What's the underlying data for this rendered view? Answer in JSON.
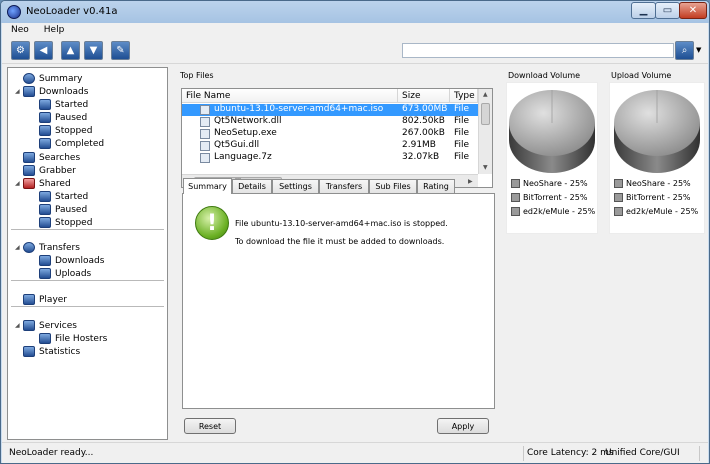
{
  "window": {
    "title": "NeoLoader v0.41a"
  },
  "menu": [
    "Neo",
    "Help"
  ],
  "toolbar": {
    "search_value": ""
  },
  "nav": {
    "items": [
      {
        "label": "Summary",
        "level": 0,
        "arrow": "",
        "icon": "summary-icon"
      },
      {
        "label": "Downloads",
        "level": 0,
        "arrow": "◢",
        "icon": "downloads-icon"
      },
      {
        "label": "Started",
        "level": 1,
        "arrow": "",
        "icon": "started-icon"
      },
      {
        "label": "Paused",
        "level": 1,
        "arrow": "",
        "icon": "paused-icon"
      },
      {
        "label": "Stopped",
        "level": 1,
        "arrow": "",
        "icon": "stopped-icon"
      },
      {
        "label": "Completed",
        "level": 1,
        "arrow": "",
        "icon": "completed-icon"
      },
      {
        "label": "Searches",
        "level": 0,
        "arrow": "",
        "icon": "searches-icon"
      },
      {
        "label": "Grabber",
        "level": 0,
        "arrow": "",
        "icon": "grabber-icon"
      },
      {
        "label": "Shared",
        "level": 0,
        "arrow": "◢",
        "icon": "shared-icon"
      },
      {
        "label": "Started",
        "level": 1,
        "arrow": "",
        "icon": "started-icon"
      },
      {
        "label": "Paused",
        "level": 1,
        "arrow": "",
        "icon": "paused-icon"
      },
      {
        "label": "Stopped",
        "level": 1,
        "arrow": "",
        "icon": "stopped-icon"
      },
      {
        "label": "Transfers",
        "level": 0,
        "arrow": "◢",
        "icon": "transfers-icon"
      },
      {
        "label": "Downloads",
        "level": 1,
        "arrow": "",
        "icon": "downloads-icon"
      },
      {
        "label": "Uploads",
        "level": 1,
        "arrow": "",
        "icon": "uploads-icon"
      },
      {
        "label": "Player",
        "level": 0,
        "arrow": "",
        "icon": "player-icon"
      },
      {
        "label": "Services",
        "level": 0,
        "arrow": "◢",
        "icon": "services-icon"
      },
      {
        "label": "File Hosters",
        "level": 1,
        "arrow": "",
        "icon": "file-hosters-icon"
      },
      {
        "label": "Statistics",
        "level": 0,
        "arrow": "",
        "icon": "statistics-icon"
      }
    ]
  },
  "top_files": {
    "title": "Top Files",
    "columns": [
      "File Name",
      "Size",
      "Type"
    ],
    "rows": [
      {
        "name": "ubuntu-13.10-server-amd64+mac.iso",
        "size": "673.00MB",
        "type": "File",
        "selected": true
      },
      {
        "name": "Qt5Network.dll",
        "size": "802.50kB",
        "type": "File",
        "selected": false
      },
      {
        "name": "NeoSetup.exe",
        "size": "267.00kB",
        "type": "File",
        "selected": false
      },
      {
        "name": "Qt5Gui.dll",
        "size": "2.91MB",
        "type": "File",
        "selected": false
      },
      {
        "name": "Language.7z",
        "size": "32.07kB",
        "type": "File",
        "selected": false
      }
    ]
  },
  "tabs": [
    "Summary",
    "Details",
    "Settings",
    "Transfers",
    "Sub Files",
    "Rating"
  ],
  "summary": {
    "line1": "File ubuntu-13.10-server-amd64+mac.iso is stopped.",
    "line2": "To download the file it must be added to downloads."
  },
  "buttons": {
    "reset": "Reset",
    "apply": "Apply"
  },
  "download_volume": {
    "title": "Download Volume",
    "legend": [
      "NeoShare - 25%",
      "BitTorrent - 25%",
      "ed2k/eMule - 25%"
    ]
  },
  "upload_volume": {
    "title": "Upload Volume",
    "legend": [
      "NeoShare - 25%",
      "BitTorrent - 25%",
      "ed2k/eMule - 25%"
    ]
  },
  "status": {
    "left": "NeoLoader ready...",
    "latency": "Core Latency: 2 ms",
    "mode": "Unified Core/GUI"
  },
  "colors": {
    "selection": "#3399ff",
    "accent": "#1e4f93"
  }
}
